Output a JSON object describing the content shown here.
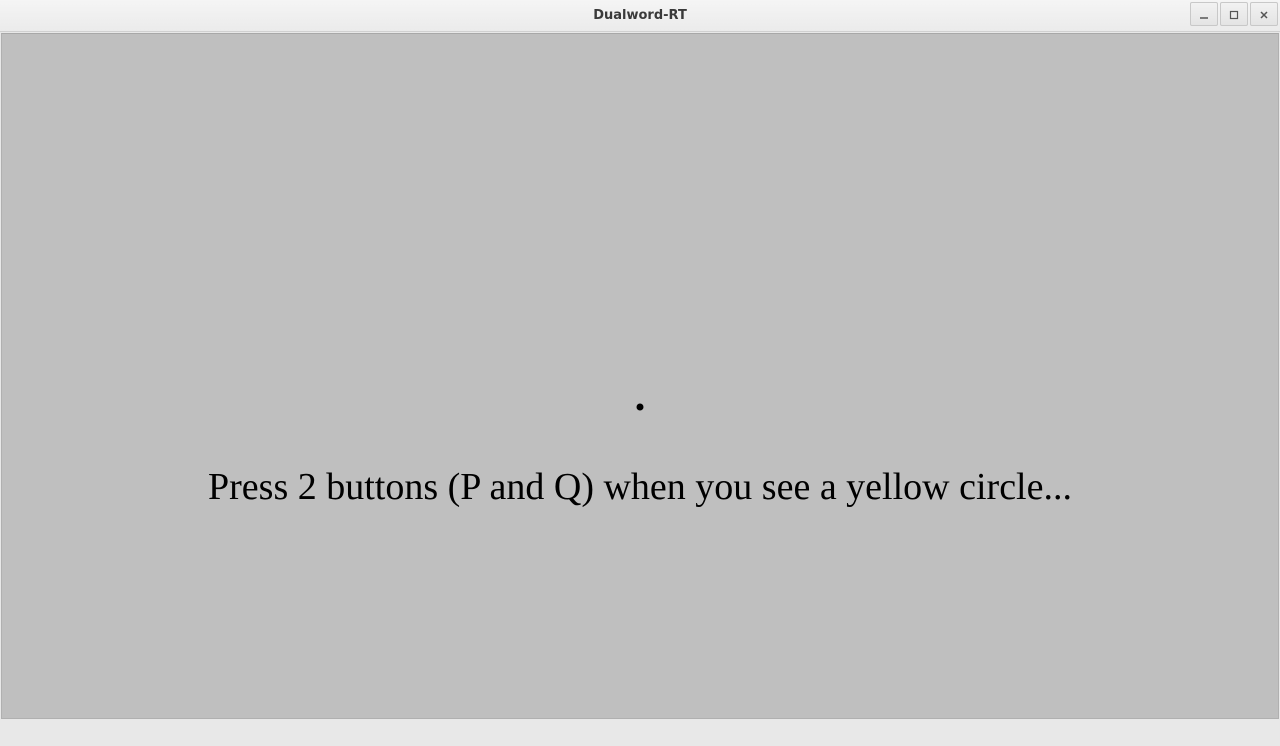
{
  "window": {
    "title": "Dualword-RT"
  },
  "content": {
    "instruction": "Press 2 buttons (P and Q) when you see a yellow circle..."
  }
}
